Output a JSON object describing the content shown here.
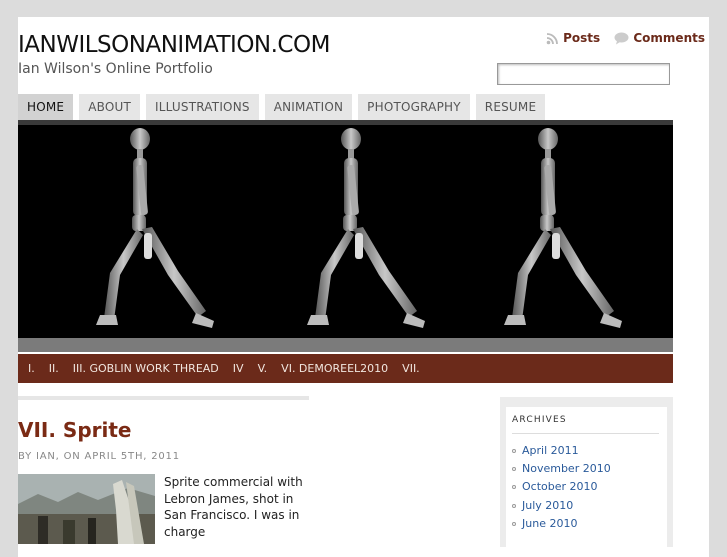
{
  "header": {
    "site_title": "IANWILSONANIMATION.COM",
    "site_description": "Ian Wilson's Online Portfolio",
    "feeds": {
      "posts_label": "Posts",
      "comments_label": "Comments"
    },
    "search": {
      "value": "",
      "placeholder": ""
    }
  },
  "nav": {
    "tabs": [
      {
        "label": "HOME",
        "active": true
      },
      {
        "label": "ABOUT"
      },
      {
        "label": "ILLUSTRATIONS"
      },
      {
        "label": "ANIMATION"
      },
      {
        "label": "PHOTOGRAPHY"
      },
      {
        "label": "RESUME"
      }
    ]
  },
  "categories": [
    "I.",
    "II.",
    "III. GOBLIN WORK THREAD",
    "IV",
    "V.",
    "VI. DEMOREEL2010",
    "VII."
  ],
  "post": {
    "title": "VII. Sprite",
    "meta": "BY IAN, ON APRIL 5TH, 2011",
    "excerpt": "Sprite commercial with Lebron James, shot in San Francisco. I was in charge"
  },
  "sidebar": {
    "archives_heading": "ARCHIVES",
    "archives": [
      "April 2011",
      "November 2010",
      "October 2010",
      "July 2010",
      "June 2010"
    ]
  },
  "colors": {
    "accent": "#6b2a1a",
    "post_title": "#7a2a14",
    "link": "#2a5a9a",
    "page_bg": "#dcdcdc"
  }
}
